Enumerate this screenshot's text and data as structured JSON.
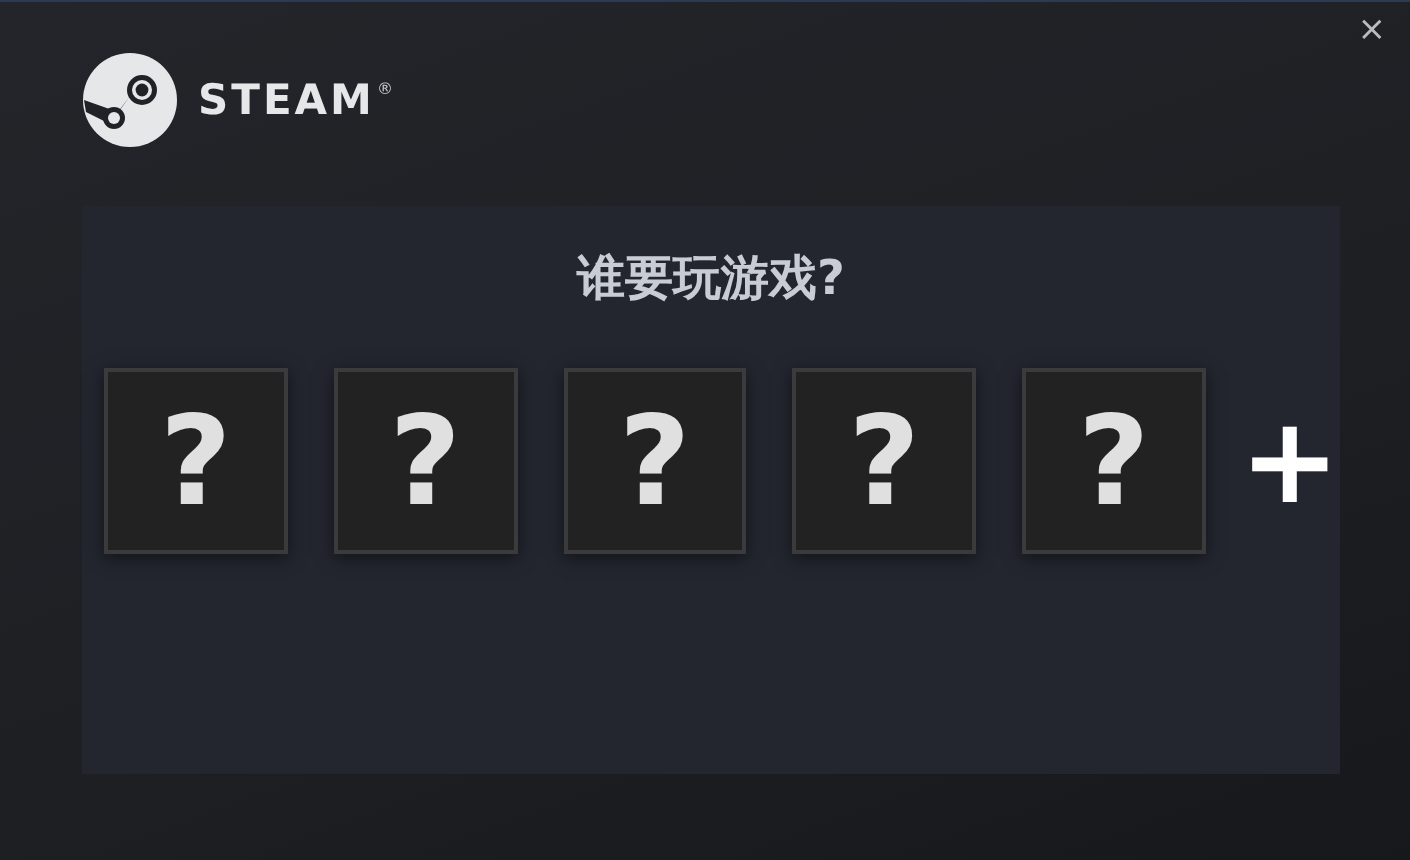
{
  "window": {
    "close": "×"
  },
  "logo": {
    "text": "STEAM",
    "mark": "®"
  },
  "panel": {
    "title": "谁要玩游戏?",
    "profiles": [
      {
        "label": "?"
      },
      {
        "label": "?"
      },
      {
        "label": "?"
      },
      {
        "label": "?"
      },
      {
        "label": "?"
      }
    ],
    "add_button": "+"
  }
}
